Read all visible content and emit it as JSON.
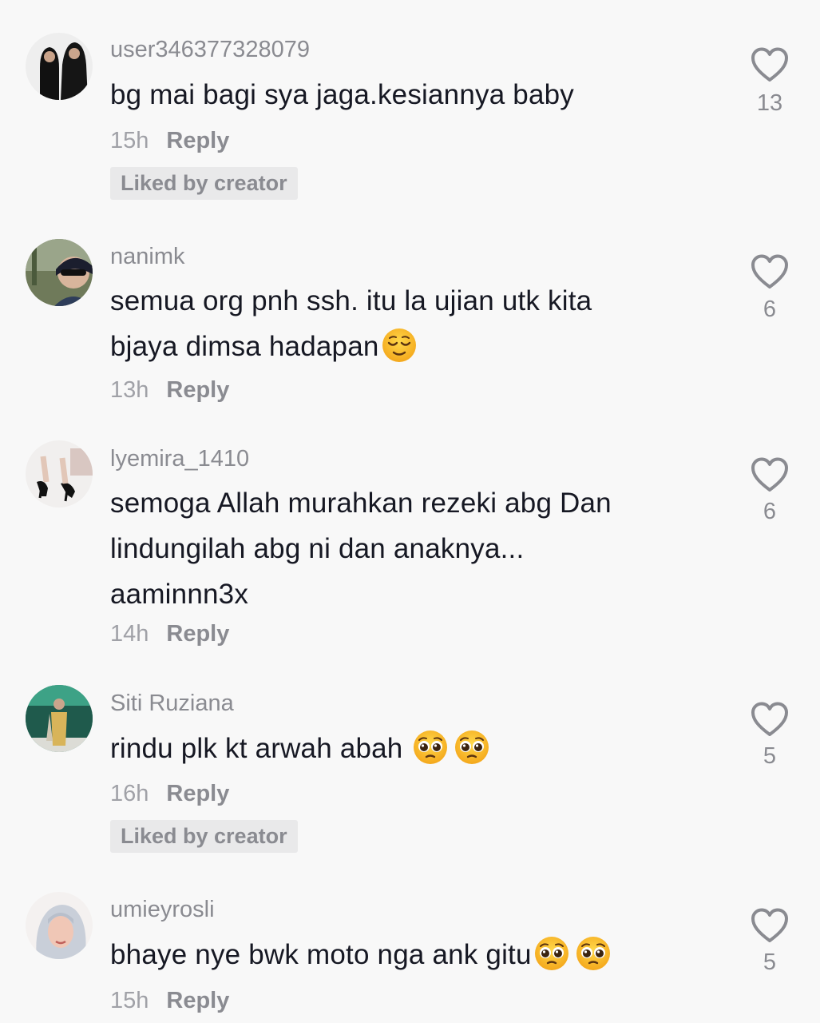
{
  "comments": [
    {
      "username": "user346377328079",
      "text_lines": [
        "bg mai bagi sya jaga.kesiannya baby"
      ],
      "time": "15h",
      "reply": "Reply",
      "liked_by_creator": "Liked by creator",
      "likes": "13"
    },
    {
      "username": "nanimk",
      "text_lines": [
        "semua org pnh ssh. itu la ujian utk kita",
        "bjaya dimsa hadapan"
      ],
      "emoji": "relieved-face-emoji",
      "time": "13h",
      "reply": "Reply",
      "likes": "6"
    },
    {
      "username": "lyemira_1410",
      "text_lines": [
        "semoga Allah murahkan rezeki abg Dan",
        "lindungilah abg ni dan anaknya...",
        "aaminnn3x"
      ],
      "time": "14h",
      "reply": "Reply",
      "likes": "6"
    },
    {
      "username": "Siti Ruziana",
      "text_lines": [
        "rindu plk kt arwah abah "
      ],
      "emoji": "pleading-face-emoji",
      "time": "16h",
      "reply": "Reply",
      "liked_by_creator": "Liked by creator",
      "likes": "5"
    },
    {
      "username": "umieyrosli",
      "text_lines": [
        "bhaye nye bwk moto nga ank gitu"
      ],
      "emoji": "pleading-face-emoji",
      "time": "15h",
      "reply": "Reply",
      "likes": "5"
    }
  ],
  "icons": {
    "like": "heart-outline-icon"
  },
  "colors": {
    "background": "#f8f8f8",
    "username": "#8a8b91",
    "text": "#161823",
    "badge_bg": "#e9e9ea",
    "heart_stroke": "#8a8b91",
    "emoji_yellow": "#fcc21b"
  }
}
